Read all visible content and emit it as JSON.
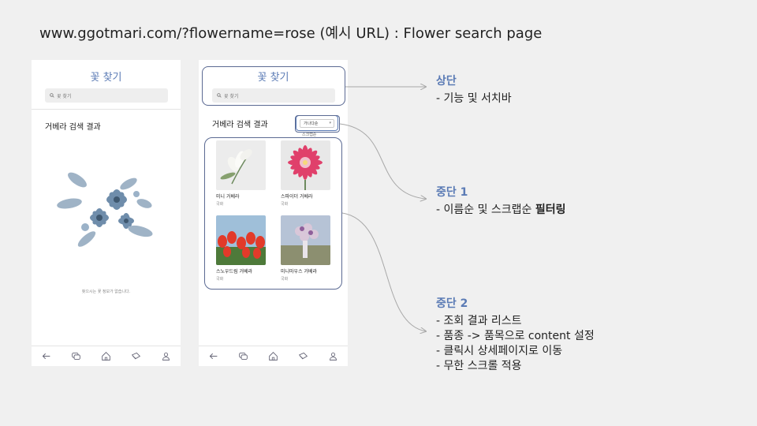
{
  "slide_title": "www.ggotmari.com/?flowername=rose (예시 URL) : Flower search page",
  "phone_left": {
    "title": "꽃 찾기",
    "search_placeholder": "꽃 찾기",
    "heading": "거베라 검색 결과",
    "empty_message": "찾으시는 꽃 정보가 없습니다."
  },
  "phone_right": {
    "title": "꽃 찾기",
    "search_placeholder": "꽃 찾기",
    "heading": "거베라 검색 결과",
    "sort_selected": "가나다순",
    "sort_option": "스크랩순",
    "results": [
      {
        "name": "미니 거베라",
        "category": "국화"
      },
      {
        "name": "스파이더 거베라",
        "category": "국화"
      },
      {
        "name": "스노우드림 거베라",
        "category": "국화"
      },
      {
        "name": "미니마우스 거베라",
        "category": "국화"
      }
    ]
  },
  "nav_icons": [
    "back-arrow-icon",
    "chat-icon",
    "home-icon",
    "card-icon",
    "user-icon"
  ],
  "annotations": {
    "top": {
      "heading": "상단",
      "lines": [
        "- 기능 및 서치바"
      ]
    },
    "middle1": {
      "heading": "중단 1",
      "line_prefix": "- 이름순 및 스크랩순 ",
      "line_bold": "필터링"
    },
    "middle2": {
      "heading": "중단 2",
      "lines": [
        "- 조회 결과 리스트",
        "- 품종 -> 품목으로 content 설정",
        "- 클릭시 상세페이지로 이동",
        "- 무한 스크롤 적용"
      ]
    }
  },
  "colors": {
    "accent": "#5b7bb5",
    "background": "#f0f0f0",
    "outline": "#5b6a93"
  }
}
